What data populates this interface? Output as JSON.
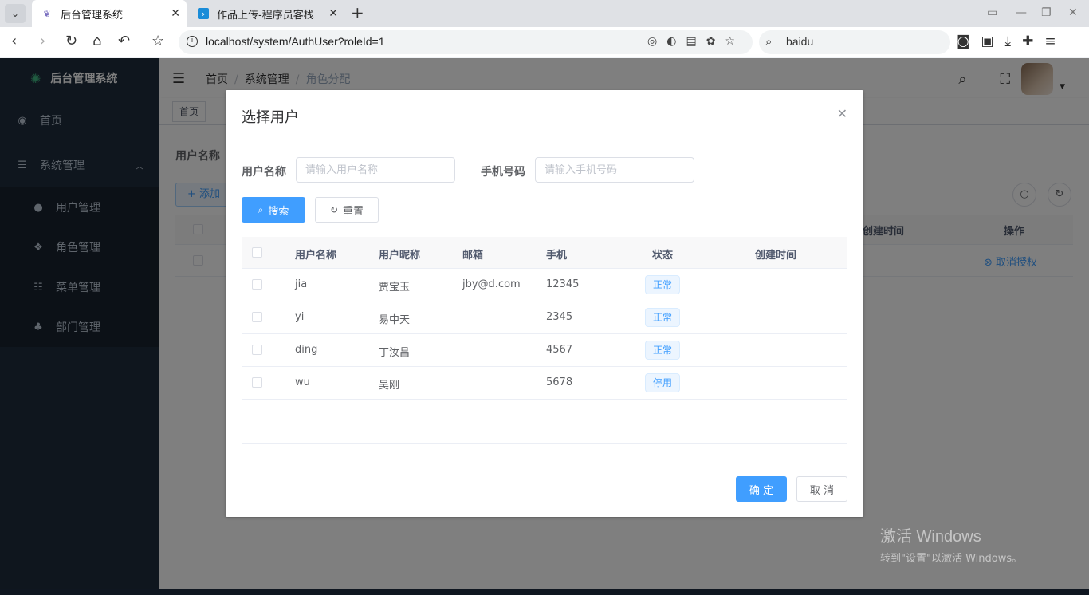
{
  "browser": {
    "tabs": [
      {
        "label": "后台管理系统",
        "active": true
      },
      {
        "label": "作品上传-程序员客栈",
        "active": false
      }
    ],
    "url": "localhost/system/AuthUser?roleId=1",
    "search_engine": "baidu"
  },
  "sidebar": {
    "logo_text": "后台管理系统",
    "items": [
      {
        "label": "首页",
        "icon": "dashboard-icon"
      },
      {
        "label": "系统管理",
        "icon": "system-icon",
        "expanded": true
      }
    ],
    "subitems": [
      {
        "label": "用户管理",
        "icon": "user-icon"
      },
      {
        "label": "角色管理",
        "icon": "peoples-icon"
      },
      {
        "label": "菜单管理",
        "icon": "tree-table-icon"
      },
      {
        "label": "部门管理",
        "icon": "tree-icon"
      }
    ]
  },
  "navbar": {
    "breadcrumb": [
      "首页",
      "系统管理",
      "角色分配"
    ]
  },
  "tagsview": {
    "tags": [
      "首页"
    ]
  },
  "background": {
    "form_label": "用户名称",
    "add_label": "添加",
    "col_created": "创建时间",
    "col_actions": "操作",
    "cancel_auth": "取消授权"
  },
  "dialog": {
    "title": "选择用户",
    "username_label": "用户名称",
    "username_placeholder": "请输入用户名称",
    "phone_label": "手机号码",
    "phone_placeholder": "请输入手机号码",
    "search_label": "搜索",
    "reset_label": "重置",
    "columns": [
      "用户名称",
      "用户昵称",
      "邮箱",
      "手机",
      "状态",
      "创建时间"
    ],
    "rows": [
      {
        "username": "jia",
        "nickname": "贾宝玉",
        "email": "jby@d.com",
        "phone": "12345",
        "status": "正常",
        "created": ""
      },
      {
        "username": "yi",
        "nickname": "易中天",
        "email": "",
        "phone": "2345",
        "status": "正常",
        "created": ""
      },
      {
        "username": "ding",
        "nickname": "丁汝昌",
        "email": "",
        "phone": "4567",
        "status": "正常",
        "created": ""
      },
      {
        "username": "wu",
        "nickname": "吴刚",
        "email": "",
        "phone": "5678",
        "status": "停用",
        "created": ""
      }
    ],
    "confirm_label": "确 定",
    "cancel_label": "取 消"
  },
  "watermark": {
    "line1": "激活 Windows",
    "line2": "转到\"设置\"以激活 Windows。"
  },
  "colors": {
    "primary": "#409eff",
    "sidebar": "#1f2d3d"
  }
}
